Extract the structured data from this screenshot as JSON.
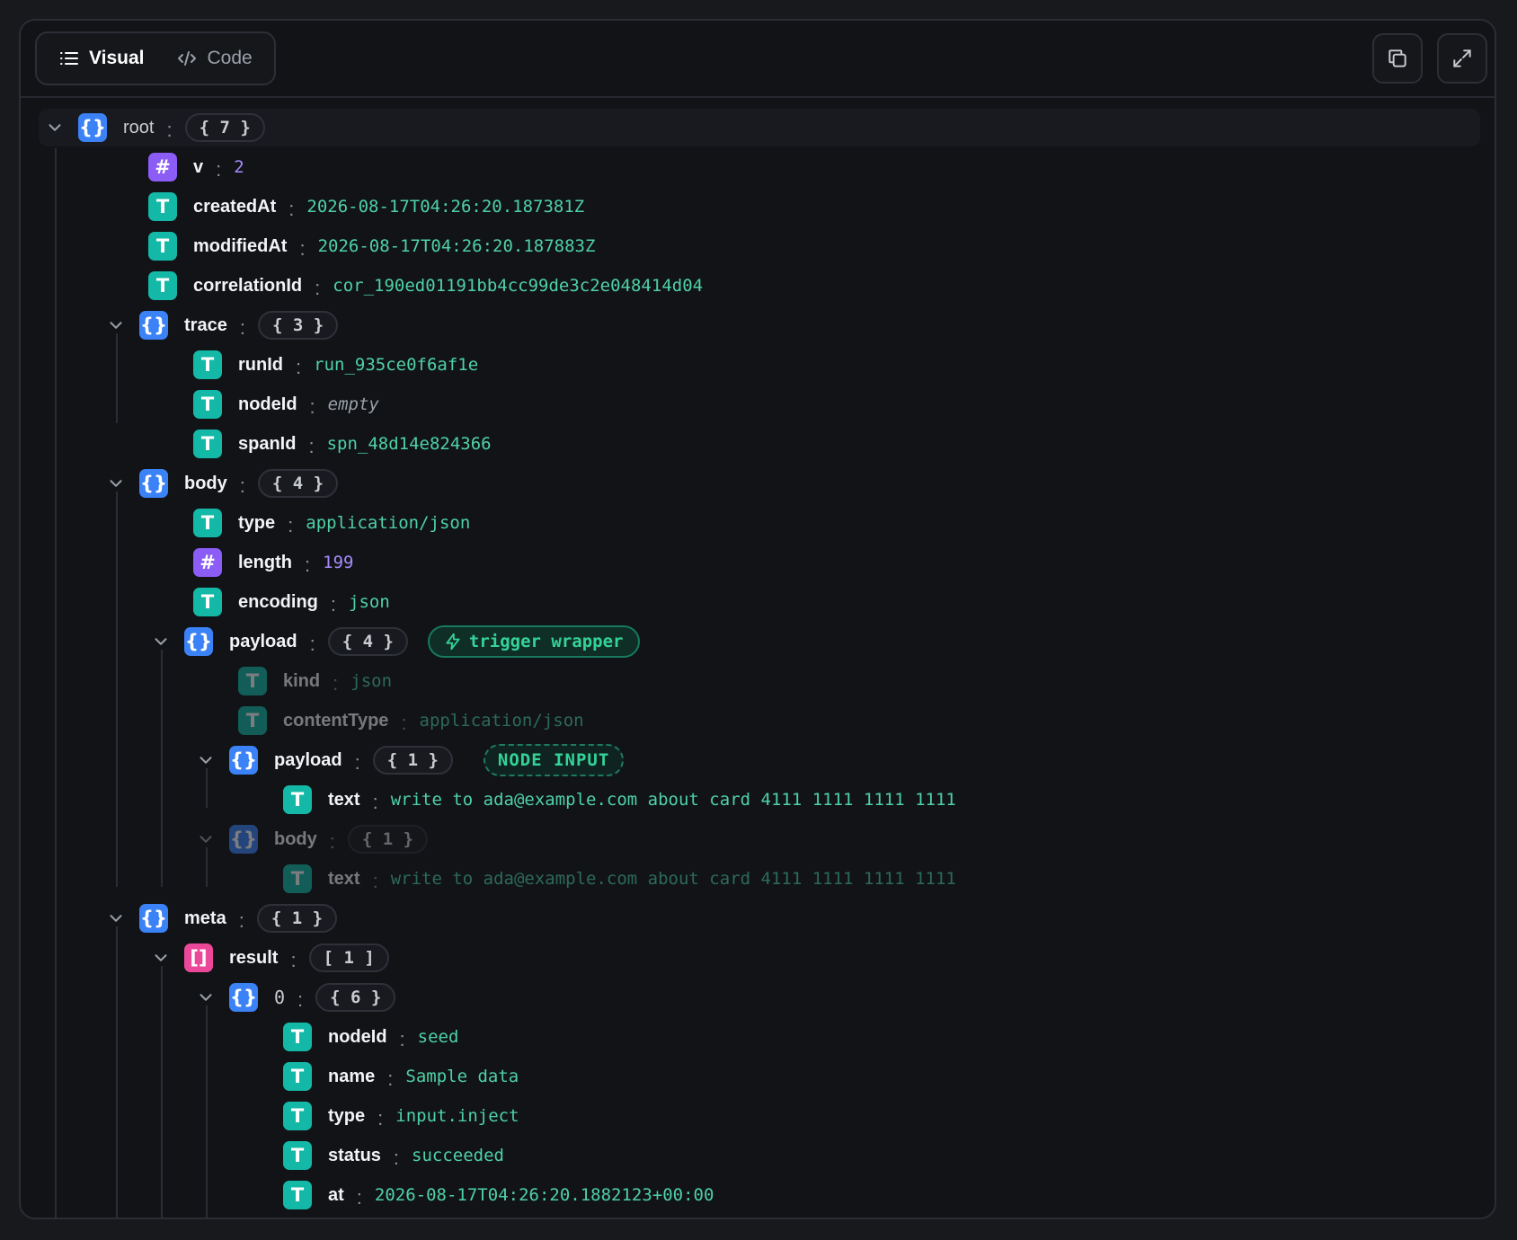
{
  "toolbar": {
    "tabs": [
      {
        "label": "Visual",
        "icon": "list-icon",
        "active": true
      },
      {
        "label": "Code",
        "icon": "code-icon",
        "active": false
      }
    ],
    "actions": [
      {
        "name": "copy-button",
        "icon": "copy-icon"
      },
      {
        "name": "expand-button",
        "icon": "expand-icon"
      }
    ]
  },
  "tree": {
    "root": {
      "key": "root",
      "count": "{ 7 }"
    },
    "v": {
      "key": "v",
      "value": "2"
    },
    "createdAt": {
      "key": "createdAt",
      "value": "2026-08-17T04:26:20.187381Z"
    },
    "modifiedAt": {
      "key": "modifiedAt",
      "value": "2026-08-17T04:26:20.187883Z"
    },
    "correlationId": {
      "key": "correlationId",
      "value": "cor_190ed01191bb4cc99de3c2e048414d04"
    },
    "trace": {
      "key": "trace",
      "count": "{ 3 }"
    },
    "runId": {
      "key": "runId",
      "value": "run_935ce0f6af1e"
    },
    "trace_nodeId": {
      "key": "nodeId",
      "value": "empty"
    },
    "spanId": {
      "key": "spanId",
      "value": "spn_48d14e824366"
    },
    "body": {
      "key": "body",
      "count": "{ 4 }"
    },
    "body_type": {
      "key": "type",
      "value": "application/json"
    },
    "length": {
      "key": "length",
      "value": "199"
    },
    "encoding": {
      "key": "encoding",
      "value": "json"
    },
    "payload": {
      "key": "payload",
      "count": "{ 4 }",
      "tag": "trigger wrapper"
    },
    "kind": {
      "key": "kind",
      "value": "json"
    },
    "contentType": {
      "key": "contentType",
      "value": "application/json"
    },
    "inner_payload": {
      "key": "payload",
      "count": "{ 1 }",
      "tag": "NODE INPUT"
    },
    "inner_payload_text": {
      "key": "text",
      "value": "write to ada@example.com about card 4111 1111 1111 1111"
    },
    "inner_body": {
      "key": "body",
      "count": "{ 1 }"
    },
    "inner_body_text": {
      "key": "text",
      "value": "write to ada@example.com about card 4111 1111 1111 1111"
    },
    "meta": {
      "key": "meta",
      "count": "{ 1 }"
    },
    "result": {
      "key": "result",
      "count": "[ 1 ]"
    },
    "result_0": {
      "key": "0",
      "count": "{ 6 }"
    },
    "r_nodeId": {
      "key": "nodeId",
      "value": "seed"
    },
    "r_name": {
      "key": "name",
      "value": "Sample data"
    },
    "r_type": {
      "key": "type",
      "value": "input.inject"
    },
    "r_status": {
      "key": "status",
      "value": "succeeded"
    },
    "r_at": {
      "key": "at",
      "value": "2026-08-17T04:26:20.1882123+00:00"
    }
  },
  "colors": {
    "object": "#3b82f6",
    "array": "#ec4899",
    "number": "#8b5cf6",
    "string": "#14b8a6",
    "string_value": "#4fd1a5",
    "number_value": "#a78bfa"
  }
}
